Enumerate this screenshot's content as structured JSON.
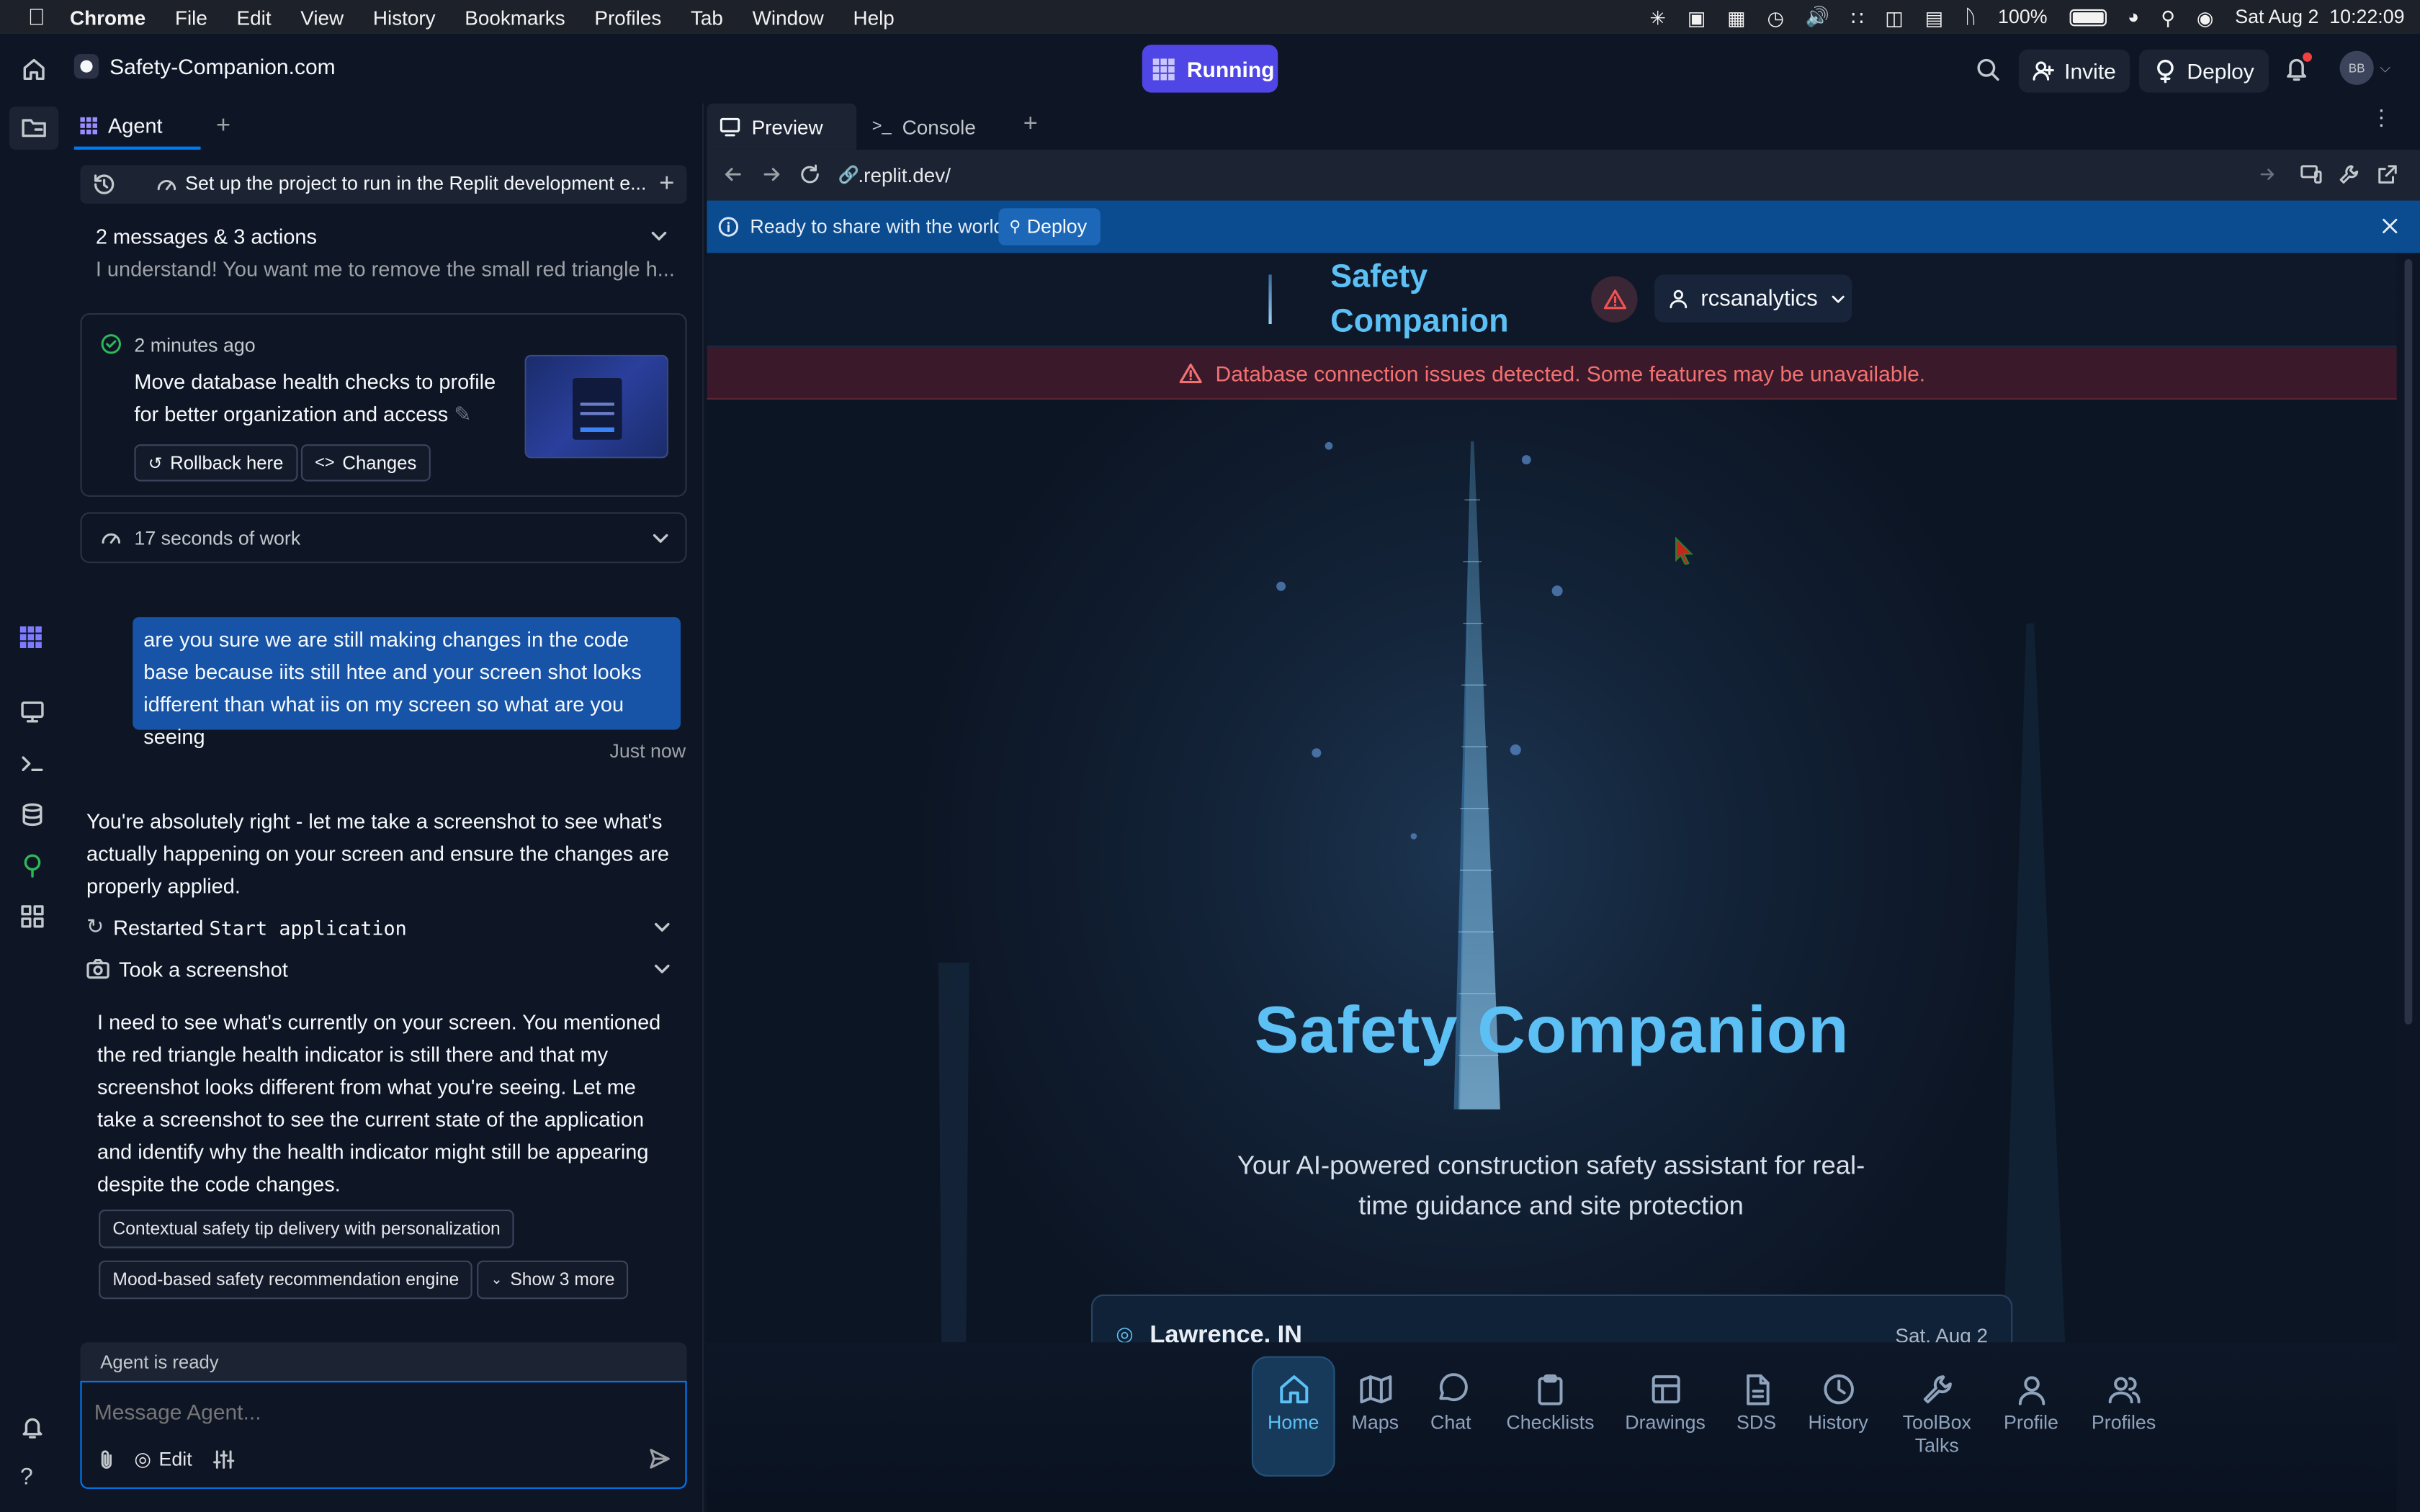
{
  "menubar": {
    "items": [
      "Chrome",
      "File",
      "Edit",
      "View",
      "History",
      "Bookmarks",
      "Profiles",
      "Tab",
      "Window",
      "Help"
    ],
    "battery": "100%",
    "datetime": "Sat Aug 2  10:22:09"
  },
  "topbar": {
    "site_title": "Safety-Companion.com",
    "run_status": "Running",
    "invite_label": "Invite",
    "deploy_label": "Deploy",
    "avatar_initials": "BB"
  },
  "agent": {
    "tab_label": "Agent",
    "task_title": "Set up the project to run in the Replit development e...",
    "summary_title": "2 messages & 3 actions",
    "summary_text": "I understand! You want me to remove the small red triangle h...",
    "checkpoint_time": "2 minutes ago",
    "checkpoint_text": "Move database health checks to profile for better organization and access",
    "rollback_label": "Rollback here",
    "changes_label": "Changes",
    "work_time": "17 seconds of work",
    "user_message": "are you sure we are still making changes in the code base because iits still htee and your screen shot looks idfferent than what iis on my screen so what are you seeing",
    "user_message_time": "Just now",
    "reply_text": "You're absolutely right - let me take a screenshot to see what's actually happening on your screen and ensure the changes are properly applied.",
    "action_restart_prefix": "Restarted ",
    "action_restart_code": "Start application",
    "action_screenshot": "Took a screenshot",
    "reasoning_text": "I need to see what's currently on your screen. You mentioned the red triangle health indicator is still there and that my screenshot looks different from what you're seeing. Let me take a screenshot to see the current state of the application and identify why the health indicator might still be appearing despite the code changes.",
    "chips": [
      "Contextual safety tip delivery with personalization",
      "Mood-based safety recommendation engine"
    ],
    "show_more_label": "Show 3 more",
    "status": "Agent is ready",
    "input_placeholder": "Message Agent...",
    "edit_label": "Edit"
  },
  "preview": {
    "tab_preview": "Preview",
    "tab_console": "Console",
    "url": ".replit.dev/",
    "banner_text": "Ready to share with the world?",
    "banner_deploy": "Deploy"
  },
  "app": {
    "brand_line1": "Safety",
    "brand_line2": "Companion",
    "user_name": "rcsanalytics",
    "error_text": "Database connection issues detected. Some features may be unavailable.",
    "hero_title": "Safety Companion",
    "hero_subtitle": "Your AI-powered construction safety assistant for real-time guidance and site protection",
    "location": "Lawrence, IN",
    "date": "Sat, Aug 2",
    "nav": [
      {
        "label": "Home",
        "icon": "home-icon"
      },
      {
        "label": "Maps",
        "icon": "map-icon"
      },
      {
        "label": "Chat",
        "icon": "chat-icon"
      },
      {
        "label": "Checklists",
        "icon": "clipboard-icon"
      },
      {
        "label": "Drawings",
        "icon": "layout-icon"
      },
      {
        "label": "SDS",
        "icon": "document-icon"
      },
      {
        "label": "History",
        "icon": "clock-icon"
      },
      {
        "label": "ToolBox Talks",
        "icon": "wrench-icon"
      },
      {
        "label": "Profile",
        "icon": "user-icon"
      },
      {
        "label": "Profiles",
        "icon": "users-icon"
      }
    ]
  },
  "colors": {
    "accent": "#4f46e5",
    "banner": "#0b4b8f",
    "error": "#f37070",
    "hero": "#5cc0f5"
  }
}
